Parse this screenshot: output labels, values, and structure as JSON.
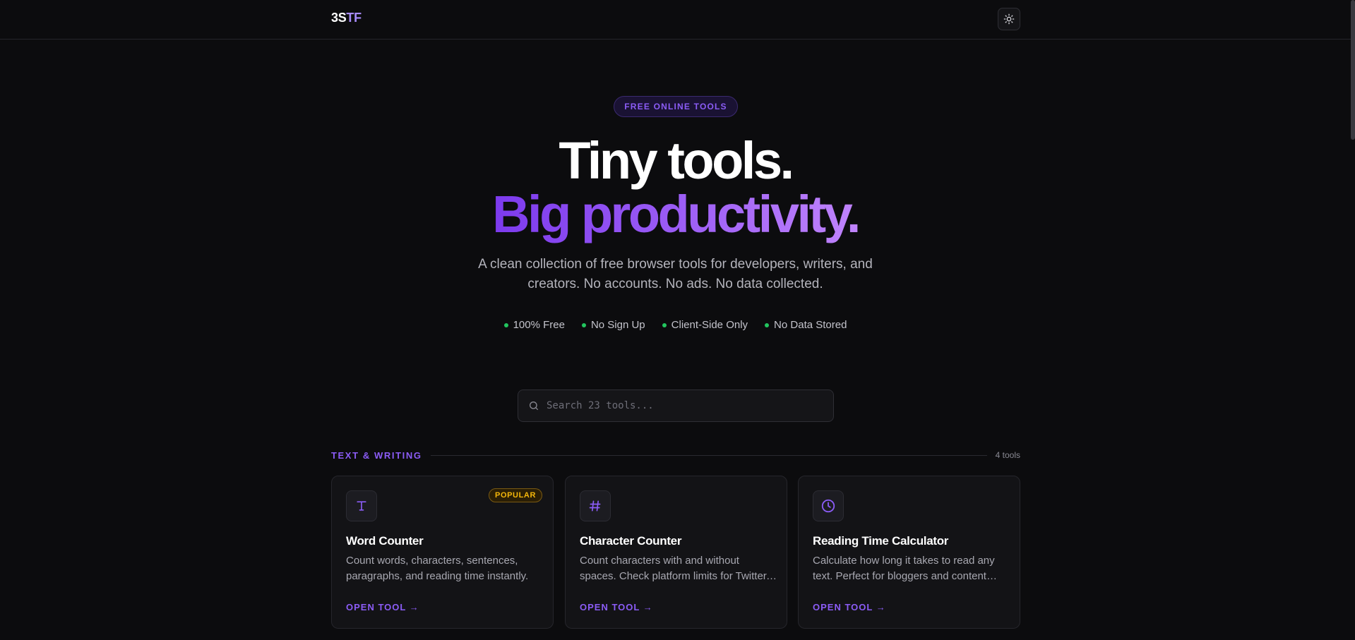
{
  "header": {
    "logo_part1": "3S",
    "logo_part2": "TF",
    "theme_toggle_icon": "sun-icon"
  },
  "hero": {
    "badge": "FREE ONLINE TOOLS",
    "headline_line1": "Tiny tools.",
    "headline_line2": "Big productivity.",
    "subtitle": "A clean collection of free browser tools for developers, writers, and creators. No accounts. No ads. No data collected.",
    "features": [
      "100% Free",
      "No Sign Up",
      "Client-Side Only",
      "No Data Stored"
    ]
  },
  "search": {
    "placeholder": "Search 23 tools...",
    "icon": "search-icon"
  },
  "section": {
    "title": "TEXT & WRITING",
    "count": "4 tools"
  },
  "cards": [
    {
      "icon": "type-icon",
      "badge": "POPULAR",
      "title": "Word Counter",
      "description": "Count words, characters, sentences, paragraphs, and reading time instantly.",
      "action": "OPEN TOOL →"
    },
    {
      "icon": "hash-icon",
      "title": "Character Counter",
      "description": "Count characters with and without spaces. Check platform limits for Twitter, Instagram and more.",
      "action": "OPEN TOOL →"
    },
    {
      "icon": "clock-icon",
      "title": "Reading Time Calculator",
      "description": "Calculate how long it takes to read any text. Perfect for bloggers and content writers.",
      "action": "OPEN TOOL →"
    }
  ],
  "colors": {
    "background": "#0c0c0e",
    "accent": "#8b5cf6",
    "feature_dot": "#22c55e",
    "popular_badge": "#f5b70a"
  }
}
